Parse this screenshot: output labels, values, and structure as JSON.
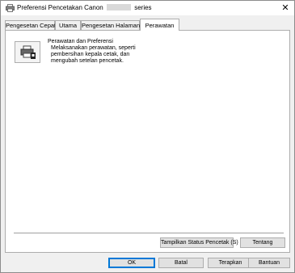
{
  "window": {
    "title_prefix": "Preferensi Pencetakan Canon",
    "title_suffix": "series",
    "close_glyph": "✕"
  },
  "tabs": [
    {
      "label": "Pengesetan Cepat",
      "active": false
    },
    {
      "label": "Utama",
      "active": false
    },
    {
      "label": "Pengesetan Halaman",
      "active": false
    },
    {
      "label": "Perawatan",
      "active": true
    }
  ],
  "maintenance": {
    "title": "Perawatan dan Preferensi",
    "description": "Melaksanakan perawatan, seperti pembersihan kepala cetak, dan mengubah setelan pencetak.",
    "icon": "printer-maintenance-icon"
  },
  "panel_buttons": {
    "status": "Tampilkan Status Pencetak (S)",
    "about": "Tentang"
  },
  "dialog_buttons": {
    "ok": "OK",
    "cancel": "Batal",
    "apply": "Terapkan",
    "help": "Bantuan"
  },
  "colors": {
    "accent": "#0078d7",
    "face": "#f0f0f0"
  }
}
